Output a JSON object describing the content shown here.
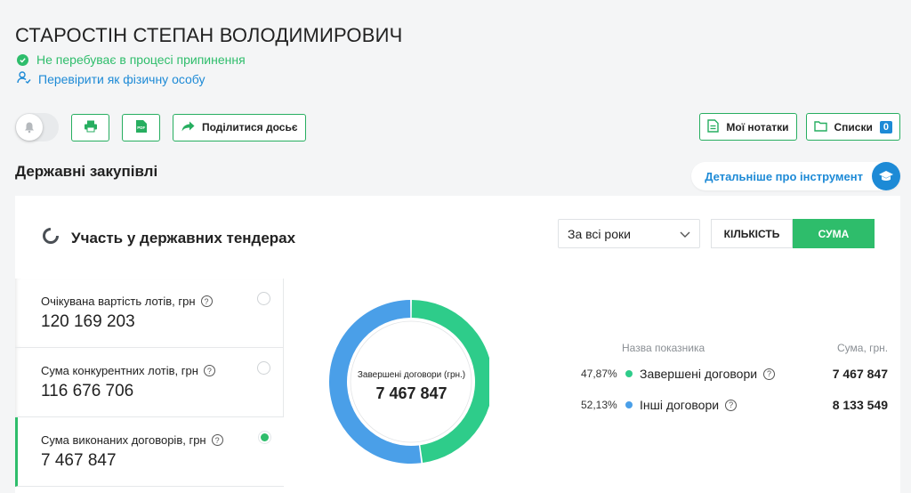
{
  "person": {
    "name": "СТАРОСТІН СТЕПАН ВОЛОДИМИРОВИЧ",
    "status": "Не перебуває в процесі припинення",
    "verify_link": "Перевірити як фізичну особу"
  },
  "toolbar": {
    "share_label": "Поділитися досьє",
    "notes_label": "Мої нотатки",
    "lists_label": "Списки",
    "lists_count": "0"
  },
  "section": {
    "title": "Державні закупівлі",
    "detail_link": "Детальніше про інструмент"
  },
  "card": {
    "title": "Участь у державних тендерах",
    "period_select": "За всі роки",
    "toggle_count": "КІЛЬКІСТЬ",
    "toggle_sum": "СУМА",
    "active_toggle": "СУМА"
  },
  "metrics": [
    {
      "label": "Очікувана вартість лотів, грн",
      "value": "120 169 203",
      "selected": false
    },
    {
      "label": "Сума конкурентних лотів, грн",
      "value": "116 676 706",
      "selected": false
    },
    {
      "label": "Сума виконаних договорів, грн",
      "value": "7 467 847",
      "selected": true
    }
  ],
  "donut": {
    "center_label": "Завершені договори (грн.)",
    "center_value": "7 467 847"
  },
  "legend": {
    "col_name": "Назва показника",
    "col_sum": "Сума, грн.",
    "rows": [
      {
        "pct": "47,87%",
        "name": "Завершені договори",
        "amount": "7 467 847",
        "color": "#2ecc8a"
      },
      {
        "pct": "52,13%",
        "name": "Інші договори",
        "amount": "8 133 549",
        "color": "#4a9fe8"
      }
    ]
  },
  "chart_data": {
    "type": "pie",
    "categories": [
      "Завершені договори",
      "Інші договори"
    ],
    "values": [
      7467847,
      8133549
    ],
    "percent": [
      47.87,
      52.13
    ],
    "colors": [
      "#2ecc8a",
      "#4a9fe8"
    ]
  },
  "colors": {
    "accent_green": "#2ebd6b",
    "link_blue": "#1d8ad6"
  }
}
